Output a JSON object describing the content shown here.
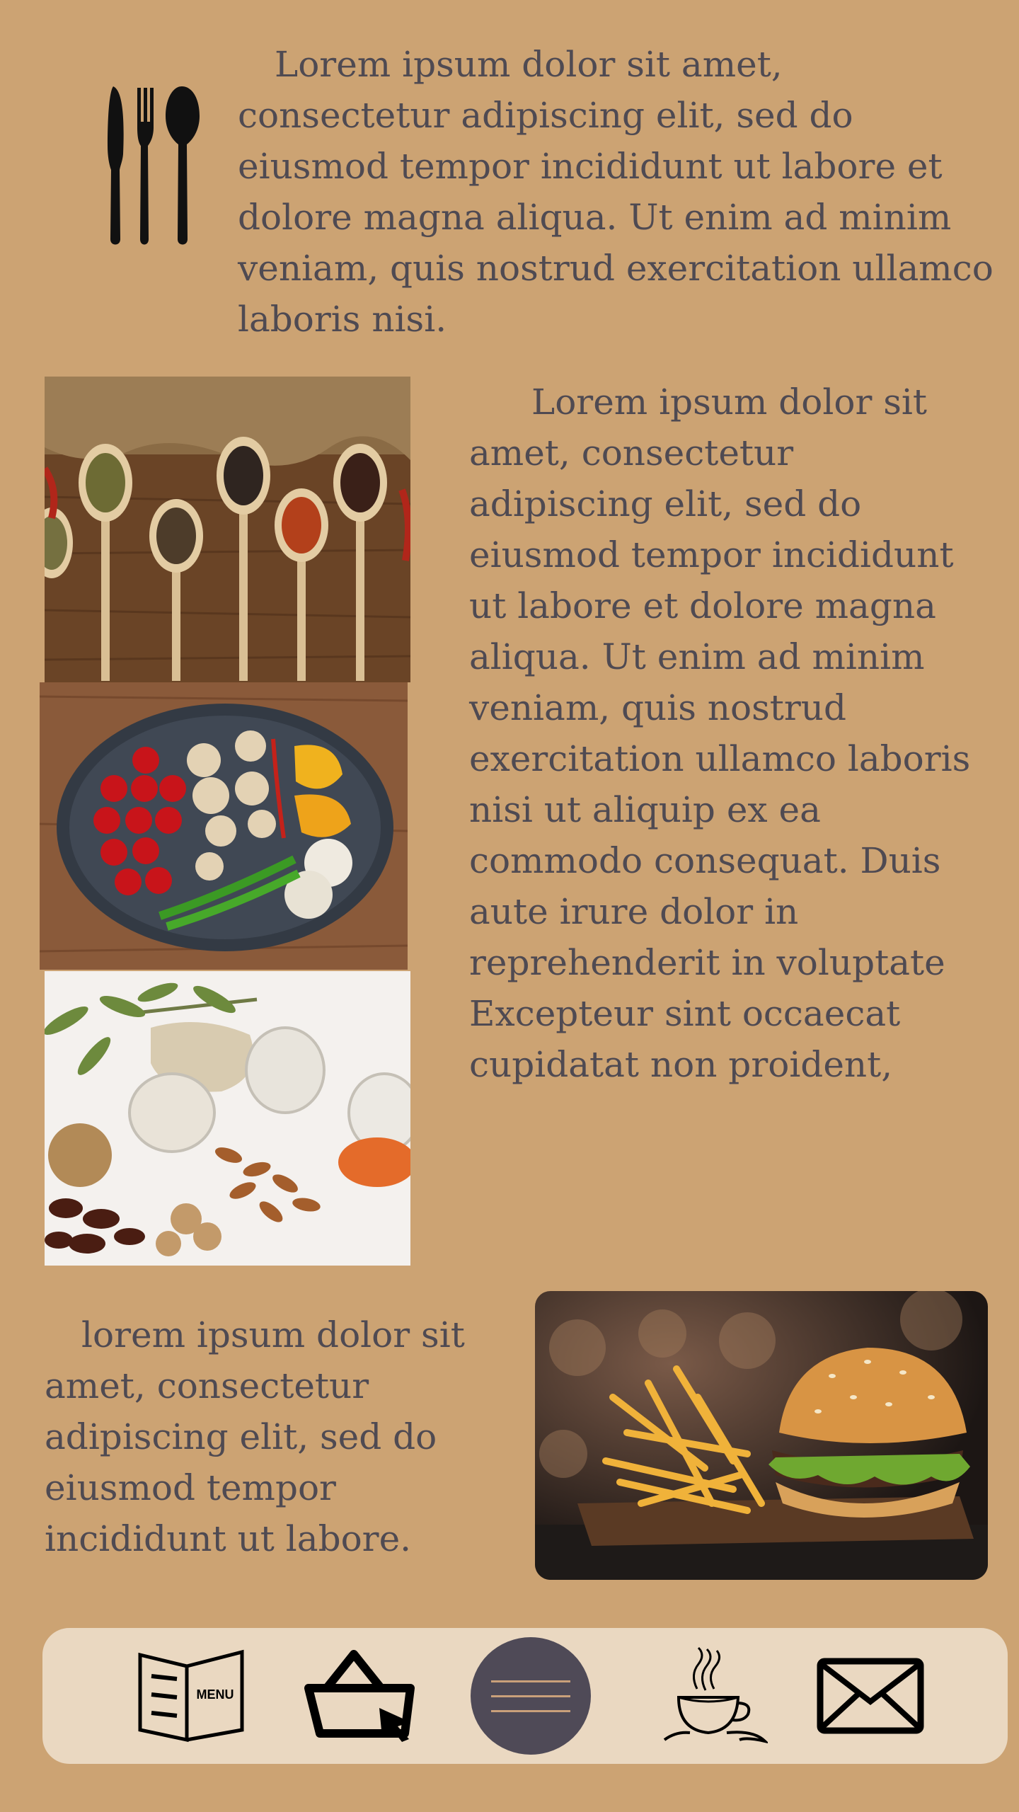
{
  "intro": {
    "text": "Lorem ipsum dolor sit amet, consectetur adipiscing elit, sed do eiusmod tempor incididunt ut labore et dolore magna aliqua. Ut enim ad minim veniam, quis nostrud exercitation ullamco laboris nisi."
  },
  "feature": {
    "text": "Lorem ipsum dolor sit amet, consectetur adipiscing elit, sed do eiusmod tempor incididunt ut labore et dolore magna aliqua. Ut enim ad minim veniam, quis nostrud exercitation ullamco laboris nisi ut aliquip ex ea commodo consequat. Duis aute irure dolor in reprehenderit in voluptate Excepteur sint occaecat cupidatat non proident,"
  },
  "bottom": {
    "text": "lorem ipsum dolor sit amet, consectetur adipiscing elit, sed do eiusmod tempor incididunt ut labore."
  },
  "nav": {
    "menu_label": "MENU",
    "items": [
      {
        "icon": "menu-book-icon"
      },
      {
        "icon": "basket-icon"
      },
      {
        "icon": "hamburger-menu-icon"
      },
      {
        "icon": "coffee-cup-icon"
      },
      {
        "icon": "envelope-icon"
      }
    ]
  },
  "colors": {
    "background": "#cca373",
    "text": "#4f4a52",
    "nav_bar": "#ead8c1",
    "nav_active": "#4f4a57"
  }
}
